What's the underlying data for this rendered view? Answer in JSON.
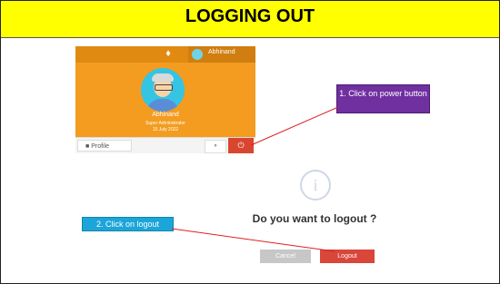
{
  "title": "LOGGING OUT",
  "profile": {
    "username": "Abhinand",
    "name": "Abhinand",
    "role": "Super Administrator",
    "date": "15 July 2022",
    "profile_button": "Profile",
    "bell_icon": "bell-icon",
    "key_icon": "key-icon",
    "power_icon": "power-icon"
  },
  "callouts": {
    "step1": "1. Click on power button",
    "step2": "2. Click on logout"
  },
  "dialog": {
    "question": "Do you want to logout ?",
    "cancel_label": "Cancel",
    "logout_label": "Logout",
    "info_icon": "info-icon"
  },
  "colors": {
    "title_bg": "#ffff00",
    "profile_bg": "#f39c1f",
    "callout1_bg": "#7030a0",
    "callout2_bg": "#1ca5d8",
    "danger": "#d9462f"
  }
}
